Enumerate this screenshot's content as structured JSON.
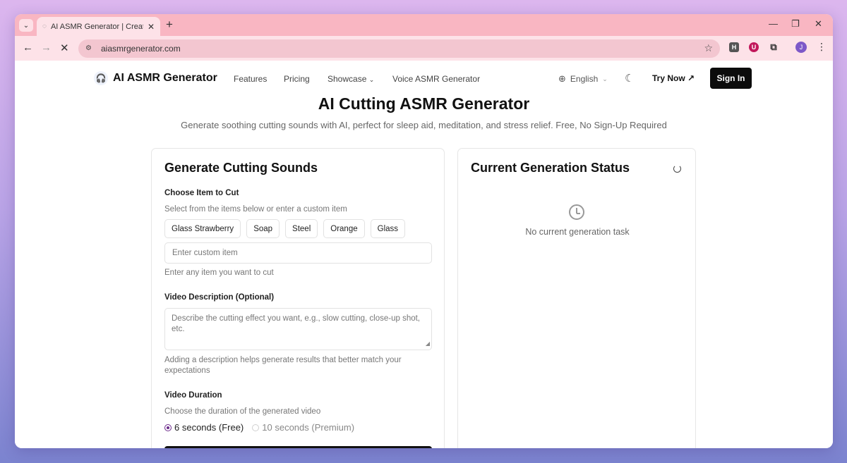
{
  "browser": {
    "tab_title": "AI ASMR Generator | Create Rel",
    "url": "aiasmrgenerator.com",
    "new_tab": "+",
    "tab_close": "✕",
    "menu_chevron": "⌄",
    "ext_h": "H",
    "ext_u": "U",
    "avatar_letter": "J"
  },
  "nav": {
    "brand": "AI ASMR Generator",
    "links": [
      "Features",
      "Pricing",
      "Showcase",
      "Voice ASMR Generator"
    ],
    "language": "English",
    "try_now": "Try Now ↗",
    "sign_in": "Sign In"
  },
  "hero": {
    "title": "AI Cutting ASMR Generator",
    "subtitle": "Generate soothing cutting sounds with AI, perfect for sleep aid, meditation, and stress relief. Free, No Sign-Up Required"
  },
  "generate": {
    "title": "Generate Cutting Sounds",
    "item_label": "Choose Item to Cut",
    "item_hint": "Select from the items below or enter a custom item",
    "items": [
      "Glass Strawberry",
      "Soap",
      "Steel",
      "Orange",
      "Glass"
    ],
    "custom_placeholder": "Enter custom item",
    "custom_hint": "Enter any item you want to cut",
    "desc_label": "Video Description (Optional)",
    "desc_placeholder": "Describe the cutting effect you want, e.g., slow cutting, close-up shot, etc.",
    "desc_hint": "Adding a description helps generate results that better match your expectations",
    "duration_label": "Video Duration",
    "duration_hint": "Choose the duration of the generated video",
    "duration_options": [
      "6 seconds (Free)",
      "10 seconds (Premium)"
    ],
    "duration_selected": "6 seconds (Free)"
  },
  "status": {
    "title": "Current Generation Status",
    "empty_text": "No current generation task"
  },
  "icons": {
    "logo": "headphones-icon",
    "spinner": "loading-spinner-icon",
    "clock": "clock-icon"
  },
  "colors": {
    "tabstrip": "#f9b6c2",
    "toolbar": "#fde2e8",
    "primary_button": "#0c0c0c",
    "radio_accent": "#6b2a8a"
  }
}
